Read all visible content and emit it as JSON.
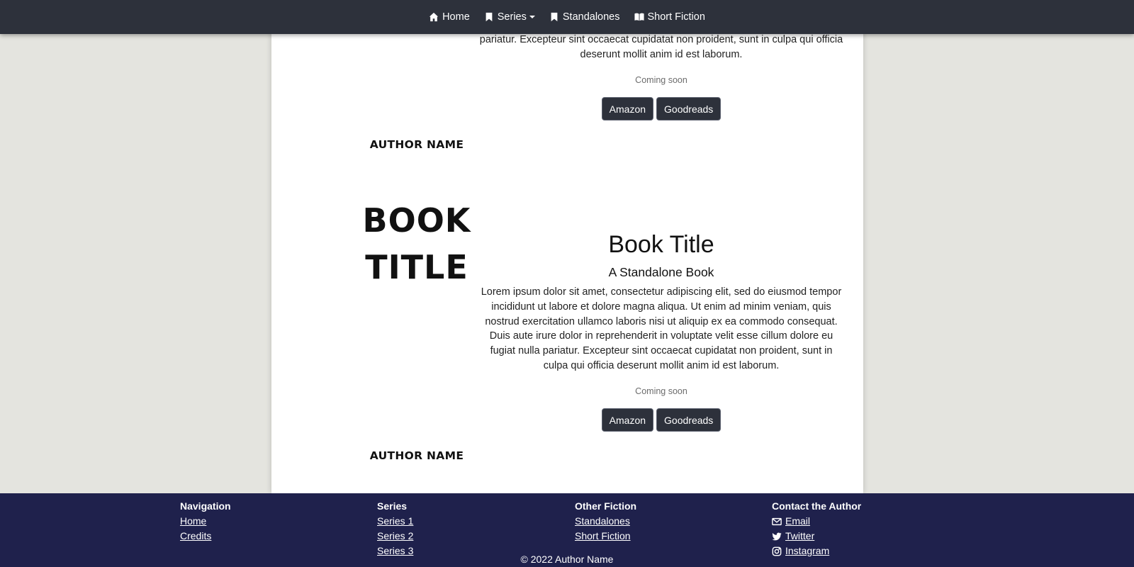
{
  "nav": {
    "home": "Home",
    "series": "Series",
    "standalones": "Standalones",
    "short_fiction": "Short Fiction"
  },
  "book1": {
    "description_tail": "pariatur. Excepteur sint occaecat cupidatat non proident, sunt in culpa qui officia deserunt mollit anim id est laborum.",
    "status": "Coming soon",
    "amazon": "Amazon",
    "goodreads": "Goodreads",
    "cover_author": "AUTHOR NAME"
  },
  "book2": {
    "cover_title": "BOOK TITLE",
    "cover_author": "AUTHOR NAME",
    "title": "Book Title",
    "subtitle": "A Standalone Book",
    "description": "Lorem ipsum dolor sit amet, consectetur adipiscing elit, sed do eiusmod tempor incididunt ut labore et dolore magna aliqua. Ut enim ad minim veniam, quis nostrud exercitation ullamco laboris nisi ut aliquip ex ea commodo consequat. Duis aute irure dolor in reprehenderit in voluptate velit esse cillum dolore eu fugiat nulla pariatur. Excepteur sint occaecat cupidatat non proident, sunt in culpa qui officia deserunt mollit anim id est laborum.",
    "status": "Coming soon",
    "amazon": "Amazon",
    "goodreads": "Goodreads"
  },
  "footer": {
    "navigation": {
      "heading": "Navigation",
      "links": [
        "Home",
        "Credits"
      ]
    },
    "series": {
      "heading": "Series",
      "links": [
        "Series 1",
        "Series 2",
        "Series 3"
      ]
    },
    "other": {
      "heading": "Other Fiction",
      "links": [
        "Standalones",
        "Short Fiction"
      ]
    },
    "contact": {
      "heading": "Contact the Author",
      "email": "Email",
      "twitter": "Twitter",
      "instagram": "Instagram"
    },
    "copyright": "© 2022 Author Name"
  },
  "colors": {
    "navbar": "#2d313b",
    "footer": "#1f214c",
    "page_bg": "#e4e4df",
    "button": "#2d313b"
  }
}
